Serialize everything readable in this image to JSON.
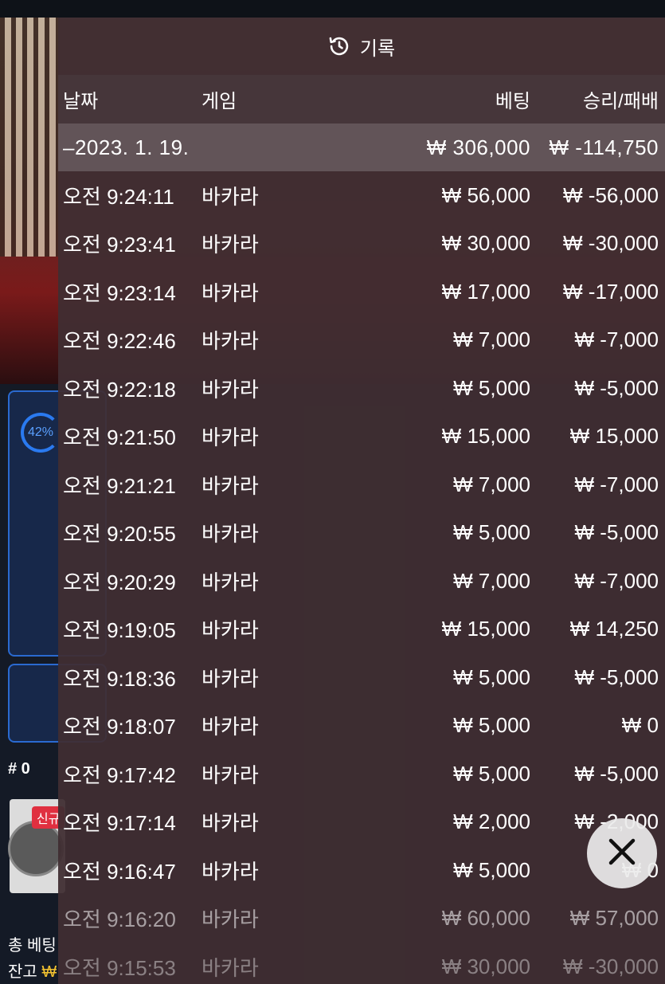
{
  "panel": {
    "title": "기록",
    "columns": {
      "date": "날짜",
      "game": "게임",
      "bet": "베팅",
      "result": "승리/패배"
    },
    "date_group": {
      "date": "–2023. 1. 19.",
      "bet": "₩ 306,000",
      "result": "₩ -114,750"
    },
    "rows": [
      {
        "time": "오전 9:24:11",
        "game": "바카라",
        "bet": "₩ 56,000",
        "result": "₩ -56,000"
      },
      {
        "time": "오전 9:23:41",
        "game": "바카라",
        "bet": "₩ 30,000",
        "result": "₩ -30,000"
      },
      {
        "time": "오전 9:23:14",
        "game": "바카라",
        "bet": "₩ 17,000",
        "result": "₩ -17,000"
      },
      {
        "time": "오전 9:22:46",
        "game": "바카라",
        "bet": "₩ 7,000",
        "result": "₩ -7,000"
      },
      {
        "time": "오전 9:22:18",
        "game": "바카라",
        "bet": "₩ 5,000",
        "result": "₩ -5,000"
      },
      {
        "time": "오전 9:21:50",
        "game": "바카라",
        "bet": "₩ 15,000",
        "result": "₩ 15,000"
      },
      {
        "time": "오전 9:21:21",
        "game": "바카라",
        "bet": "₩ 7,000",
        "result": "₩ -7,000"
      },
      {
        "time": "오전 9:20:55",
        "game": "바카라",
        "bet": "₩ 5,000",
        "result": "₩ -5,000"
      },
      {
        "time": "오전 9:20:29",
        "game": "바카라",
        "bet": "₩ 7,000",
        "result": "₩ -7,000"
      },
      {
        "time": "오전 9:19:05",
        "game": "바카라",
        "bet": "₩ 15,000",
        "result": "₩ 14,250"
      },
      {
        "time": "오전 9:18:36",
        "game": "바카라",
        "bet": "₩ 5,000",
        "result": "₩ -5,000"
      },
      {
        "time": "오전 9:18:07",
        "game": "바카라",
        "bet": "₩ 5,000",
        "result": "₩ 0"
      },
      {
        "time": "오전 9:17:42",
        "game": "바카라",
        "bet": "₩ 5,000",
        "result": "₩ -5,000"
      },
      {
        "time": "오전 9:17:14",
        "game": "바카라",
        "bet": "₩ 2,000",
        "result": "₩ -2,000"
      },
      {
        "time": "오전 9:16:47",
        "game": "바카라",
        "bet": "₩ 5,000",
        "result": "₩ 0"
      },
      {
        "time": "오전 9:16:20",
        "game": "바카라",
        "bet": "₩ 60,000",
        "result": "₩ 57,000"
      },
      {
        "time": "오전 9:15:53",
        "game": "바카라",
        "bet": "₩ 30,000",
        "result": "₩ -30,000"
      }
    ]
  },
  "background": {
    "gauge_percent": "42%",
    "round_label": "# 0",
    "new_badge": "신규",
    "total_bet_label": "총 베팅",
    "balance_label": "잔고",
    "balance_currency": "₩"
  },
  "colors": {
    "accent_blue": "#2a6ad0",
    "new_badge": "#e03040",
    "balance_gold": "#f2c230"
  },
  "icons": {
    "title_icon": "history-icon",
    "close_icon": "close-icon"
  }
}
